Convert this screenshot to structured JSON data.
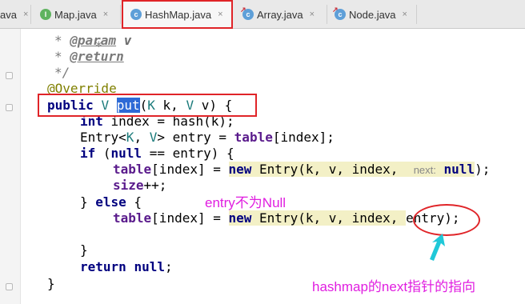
{
  "tabs": [
    {
      "label": "ava",
      "icon": "none",
      "active": false
    },
    {
      "label": "Map.java",
      "icon": "interface-icon",
      "active": false
    },
    {
      "label": "HashMap.java",
      "icon": "class-icon",
      "active": true
    },
    {
      "label": "Array.java",
      "icon": "class-icon",
      "active": false
    },
    {
      "label": "Node.java",
      "icon": "class-icon",
      "active": false
    }
  ],
  "tab_close_glyph": "×",
  "icon_letters": {
    "interface": "I",
    "class": "c"
  },
  "code": {
    "l1_star": "*",
    "l2_star": "* ",
    "l2_tag": "@param",
    "l2_name": "v",
    "l3_star": "* ",
    "l3_tag": "@return",
    "l4_end": "*/",
    "l5_annotation": "@Override",
    "l6_public": "public",
    "l6_type_v": "V",
    "l6_sel": "put",
    "l6_rest_a": "(",
    "l6_k_type": "K",
    "l6_rest_b": " k, ",
    "l6_v_type": "V",
    "l6_rest_c": " v) {",
    "l7_int": "int",
    "l7_rest": " index = hash(k);",
    "l8_a": "Entry<",
    "l8_k": "K",
    "l8_b": ", ",
    "l8_v": "V",
    "l8_c": "> entry = ",
    "l8_table": "table",
    "l8_d": "[index];",
    "l9_if": "if",
    "l9_a": " (",
    "l9_null": "null",
    "l9_b": " == entry) {",
    "l10_table": "table",
    "l10_a": "[index] = ",
    "l10_new": "new",
    "l10_b": " Entry(k, v, index,  ",
    "l10_hint": "next:",
    "l10_null": "null",
    "l10_c": ");",
    "l11_size": "size",
    "l11_a": "++;",
    "l12_a": "} ",
    "l12_else": "else",
    "l12_b": " {",
    "l13_table": "table",
    "l13_a": "[index] = ",
    "l13_new": "new",
    "l13_b": " Entry(k, v, index, ",
    "l13_c": "entry);",
    "l14": "}",
    "l15_return": "return",
    "l15_null": "null",
    "l15_end": ";",
    "l16": "}"
  },
  "annotations": {
    "entry_not_null": "entry不为Null",
    "next_pointer": "hashmap的next指针的指向"
  },
  "colors": {
    "red_box": "#e02428",
    "magenta_note": "#e01ee0",
    "cyan_arrow": "#20c8d8",
    "keyword": "#00007f",
    "field": "#5a1b8c",
    "selection": "#2d6ad6"
  }
}
